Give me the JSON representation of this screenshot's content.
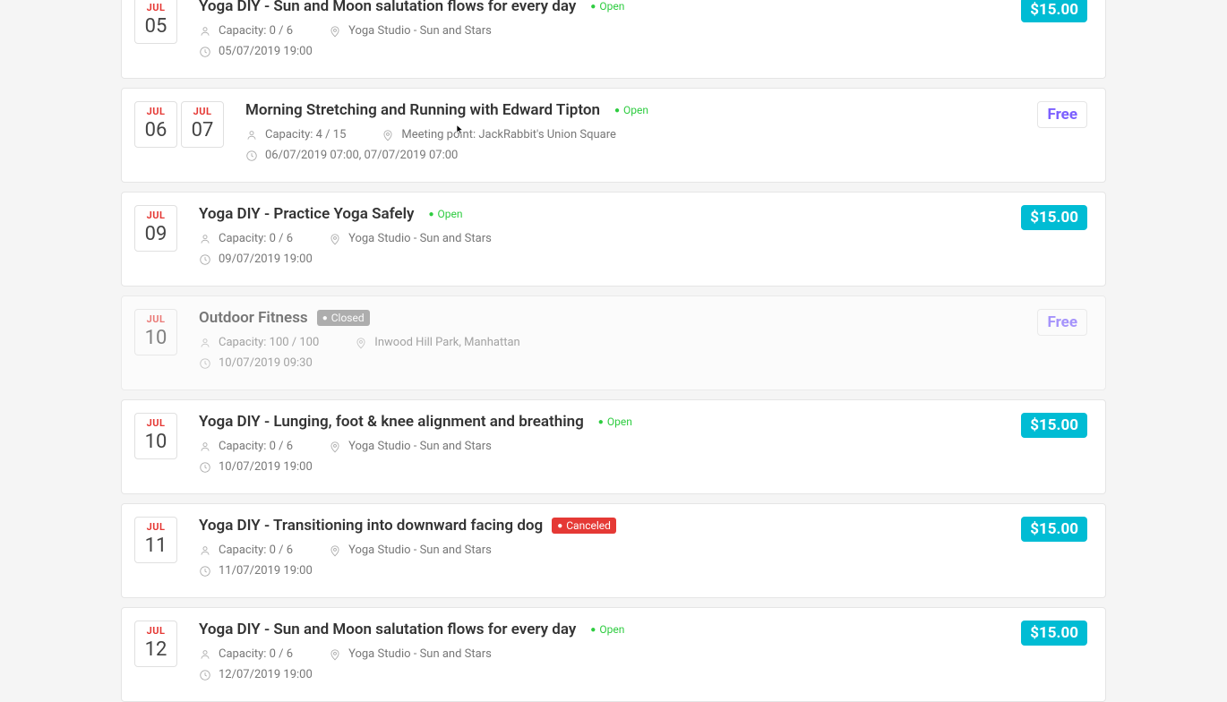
{
  "events": [
    {
      "dates": [
        {
          "month": "JUL",
          "day": "05"
        }
      ],
      "title": "Yoga DIY - Sun and Moon salutation flows for every day",
      "status": {
        "label": "Open",
        "kind": "open"
      },
      "capacity": "Capacity: 0 / 6",
      "location": "Yoga Studio - Sun and Stars",
      "datetime": "05/07/2019 19:00",
      "price": {
        "label": "$15.00",
        "kind": "paid"
      },
      "partial": "top"
    },
    {
      "dates": [
        {
          "month": "JUL",
          "day": "06"
        },
        {
          "month": "JUL",
          "day": "07"
        }
      ],
      "title": "Morning Stretching and Running with Edward Tipton",
      "status": {
        "label": "Open",
        "kind": "open"
      },
      "capacity": "Capacity: 4 / 15",
      "location": "Meeting point: JackRabbit's Union Square",
      "datetime": "06/07/2019 07:00, 07/07/2019 07:00",
      "price": {
        "label": "Free",
        "kind": "free"
      }
    },
    {
      "dates": [
        {
          "month": "JUL",
          "day": "09"
        }
      ],
      "title": "Yoga DIY - Practice Yoga Safely",
      "status": {
        "label": "Open",
        "kind": "open"
      },
      "capacity": "Capacity: 0 / 6",
      "location": "Yoga Studio - Sun and Stars",
      "datetime": "09/07/2019 19:00",
      "price": {
        "label": "$15.00",
        "kind": "paid"
      }
    },
    {
      "dates": [
        {
          "month": "JUL",
          "day": "10"
        }
      ],
      "title": "Outdoor Fitness",
      "status": {
        "label": "Closed",
        "kind": "closed"
      },
      "capacity": "Capacity: 100 / 100",
      "location": "Inwood Hill Park, Manhattan",
      "datetime": "10/07/2019 09:30",
      "price": {
        "label": "Free",
        "kind": "free"
      },
      "dim": true
    },
    {
      "dates": [
        {
          "month": "JUL",
          "day": "10"
        }
      ],
      "title": "Yoga DIY - Lunging, foot & knee alignment and breathing",
      "status": {
        "label": "Open",
        "kind": "open"
      },
      "capacity": "Capacity: 0 / 6",
      "location": "Yoga Studio - Sun and Stars",
      "datetime": "10/07/2019 19:00",
      "price": {
        "label": "$15.00",
        "kind": "paid"
      }
    },
    {
      "dates": [
        {
          "month": "JUL",
          "day": "11"
        }
      ],
      "title": "Yoga DIY - Transitioning into downward facing dog",
      "status": {
        "label": "Canceled",
        "kind": "canceled"
      },
      "capacity": "Capacity: 0 / 6",
      "location": "Yoga Studio - Sun and Stars",
      "datetime": "11/07/2019 19:00",
      "price": {
        "label": "$15.00",
        "kind": "paid"
      }
    },
    {
      "dates": [
        {
          "month": "JUL",
          "day": "12"
        }
      ],
      "title": "Yoga DIY - Sun and Moon salutation flows for every day",
      "status": {
        "label": "Open",
        "kind": "open"
      },
      "capacity": "Capacity: 0 / 6",
      "location": "Yoga Studio - Sun and Stars",
      "datetime": "12/07/2019 19:00",
      "price": {
        "label": "$15.00",
        "kind": "paid"
      },
      "partial": "bottom"
    }
  ]
}
